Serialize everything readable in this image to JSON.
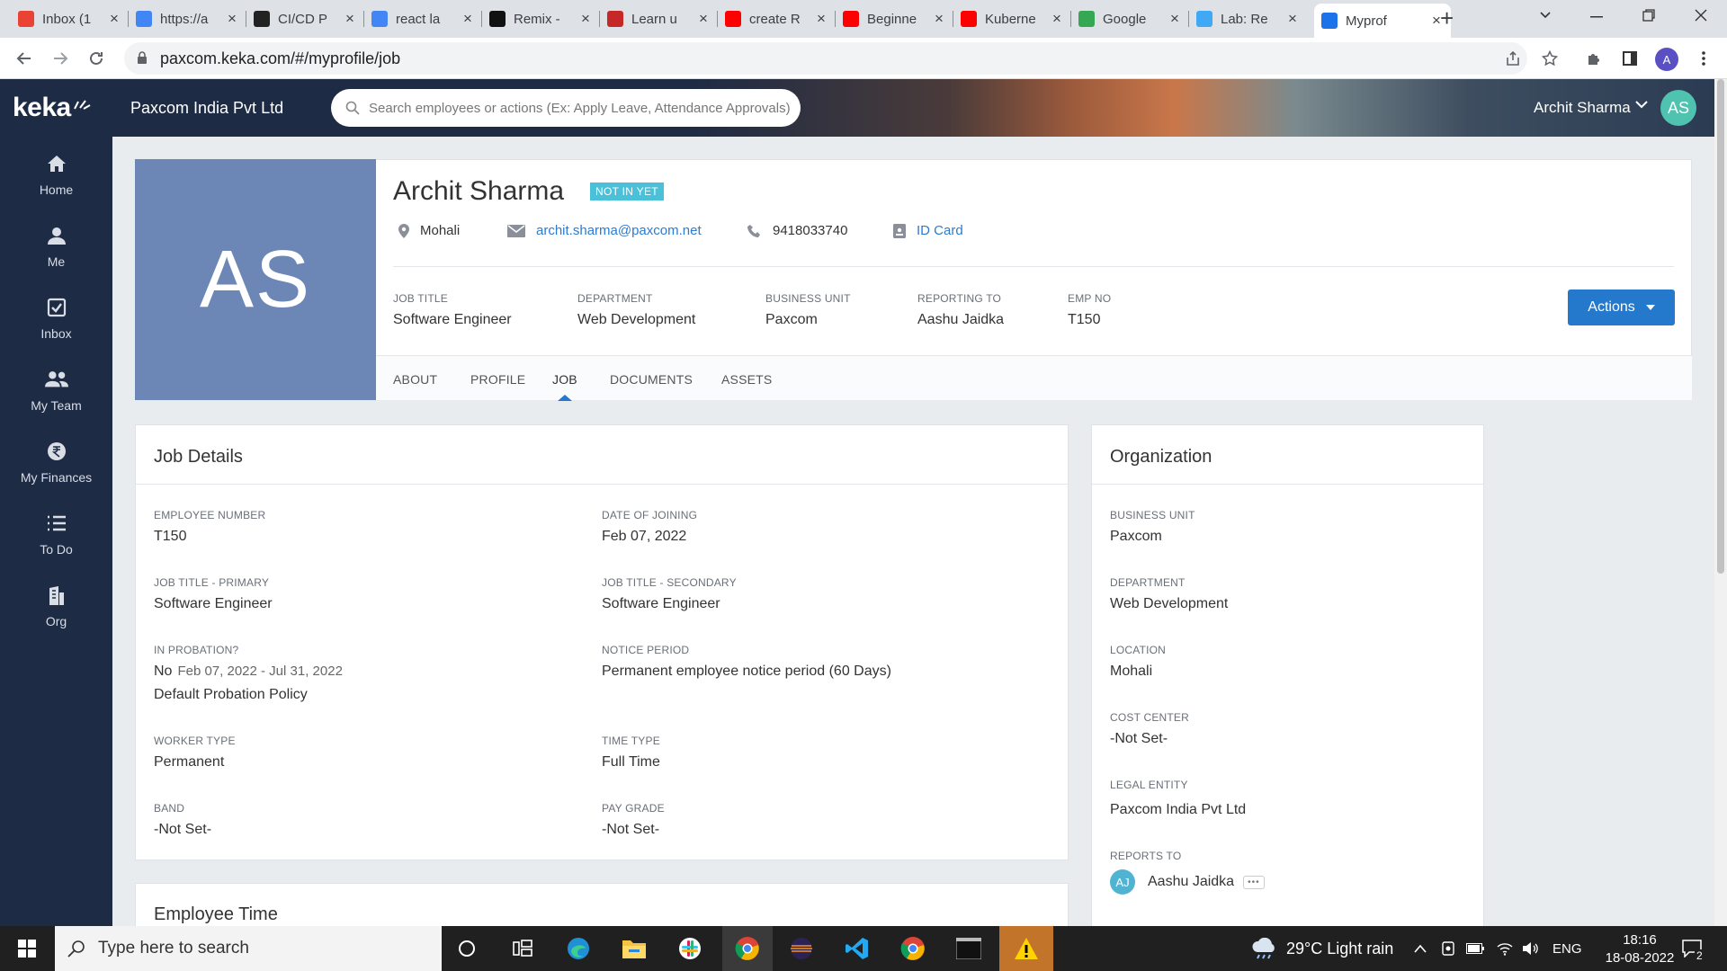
{
  "browser": {
    "tabs": [
      {
        "title": "Inbox (1",
        "favicon": "gmail-icon",
        "color": "#ea4335"
      },
      {
        "title": "https://a",
        "favicon": "google-icon",
        "color": "#4285f4"
      },
      {
        "title": "CI/CD P",
        "favicon": "pipeline-icon",
        "color": "#222222"
      },
      {
        "title": "react la",
        "favicon": "google-icon",
        "color": "#4285f4"
      },
      {
        "title": "Remix - ",
        "favicon": "remix-icon",
        "color": "#111111"
      },
      {
        "title": "Learn u",
        "favicon": "learn-icon",
        "color": "#c62828"
      },
      {
        "title": "create R",
        "favicon": "youtube-icon",
        "color": "#ff0000"
      },
      {
        "title": "Beginne",
        "favicon": "youtube-icon",
        "color": "#ff0000"
      },
      {
        "title": "Kuberne",
        "favicon": "youtube-icon",
        "color": "#ff0000"
      },
      {
        "title": "Google",
        "favicon": "google-meet-icon",
        "color": "#34a853"
      },
      {
        "title": "Lab: Re",
        "favicon": "cloud-icon",
        "color": "#3fa9f5"
      },
      {
        "title": "Myprof",
        "favicon": "keka-icon",
        "color": "#1a73e8"
      }
    ],
    "url": "paxcom.keka.com/#/myprofile/job",
    "profile_initial": "A"
  },
  "app": {
    "logo": "keka",
    "company": "Paxcom India Pvt Ltd",
    "search_placeholder": "Search employees or actions (Ex: Apply Leave, Attendance Approvals)",
    "user_name": "Archit Sharma",
    "user_initials": "AS"
  },
  "sidenav": [
    {
      "label": "Home",
      "icon": "home-icon"
    },
    {
      "label": "Me",
      "icon": "person-icon"
    },
    {
      "label": "Inbox",
      "icon": "inbox-check-icon"
    },
    {
      "label": "My Team",
      "icon": "team-icon"
    },
    {
      "label": "My Finances",
      "icon": "rupee-icon"
    },
    {
      "label": "To Do",
      "icon": "list-icon"
    },
    {
      "label": "Org",
      "icon": "building-icon"
    }
  ],
  "profile": {
    "initials": "AS",
    "name": "Archit Sharma",
    "status": "NOT IN YET",
    "location": "Mohali",
    "email": "archit.sharma@paxcom.net",
    "phone": "9418033740",
    "id_card": "ID Card",
    "fields": [
      {
        "label": "JOB TITLE",
        "value": "Software Engineer"
      },
      {
        "label": "DEPARTMENT",
        "value": "Web Development"
      },
      {
        "label": "BUSINESS UNIT",
        "value": "Paxcom"
      },
      {
        "label": "REPORTING TO",
        "value": "Aashu Jaidka"
      },
      {
        "label": "EMP NO",
        "value": "T150"
      }
    ],
    "actions_label": "Actions",
    "tabs": [
      "ABOUT",
      "PROFILE",
      "JOB",
      "DOCUMENTS",
      "ASSETS"
    ],
    "active_tab": "JOB"
  },
  "job_details": {
    "title": "Job Details",
    "employee_number": {
      "label": "EMPLOYEE NUMBER",
      "value": "T150"
    },
    "date_of_joining": {
      "label": "DATE OF JOINING",
      "value": "Feb 07, 2022"
    },
    "job_title_primary": {
      "label": "JOB TITLE - PRIMARY",
      "value": "Software Engineer"
    },
    "job_title_secondary": {
      "label": "JOB TITLE - SECONDARY",
      "value": "Software Engineer"
    },
    "in_probation": {
      "label": "IN PROBATION?",
      "value": "No",
      "range": "Feb 07, 2022 - Jul 31, 2022",
      "policy": "Default Probation Policy"
    },
    "notice_period": {
      "label": "NOTICE PERIOD",
      "value": "Permanent employee notice period (60 Days)"
    },
    "worker_type": {
      "label": "WORKER TYPE",
      "value": "Permanent"
    },
    "time_type": {
      "label": "TIME TYPE",
      "value": "Full Time"
    },
    "band": {
      "label": "BAND",
      "value": "-Not Set-"
    },
    "pay_grade": {
      "label": "PAY GRADE",
      "value": "-Not Set-"
    }
  },
  "employee_time": {
    "title": "Employee Time"
  },
  "organization": {
    "title": "Organization",
    "business_unit": {
      "label": "BUSINESS UNIT",
      "value": "Paxcom"
    },
    "department": {
      "label": "DEPARTMENT",
      "value": "Web Development"
    },
    "location": {
      "label": "LOCATION",
      "value": "Mohali"
    },
    "cost_center": {
      "label": "COST CENTER",
      "value": "-Not Set-"
    },
    "legal_entity": {
      "label": "LEGAL ENTITY",
      "value": "Paxcom India Pvt Ltd"
    },
    "reports_to": {
      "label": "REPORTS TO",
      "initials": "AJ",
      "name": "Aashu Jaidka",
      "more": "•••"
    }
  },
  "taskbar": {
    "search_placeholder": "Type here to search",
    "weather": "29°C  Light rain",
    "lang": "ENG",
    "time": "18:16",
    "date": "18-08-2022",
    "notif_count": "2"
  },
  "colors": {
    "sidebar": "#1e2b44",
    "accent": "#2479cc",
    "avatar": "#6c87b5",
    "status_badge": "#4ac0d9"
  }
}
